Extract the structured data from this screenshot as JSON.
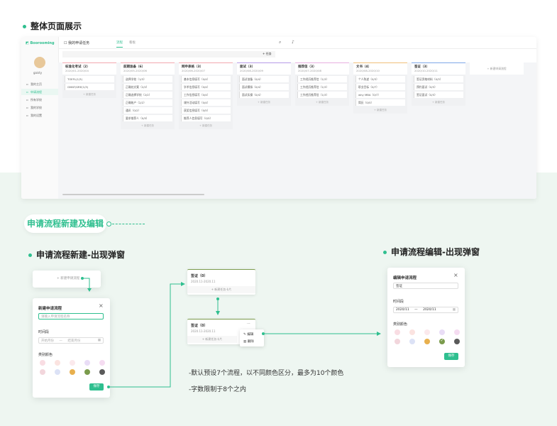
{
  "section1": {
    "title": "整体页面展示"
  },
  "app": {
    "brand": "Boorooming",
    "user": "gaisty",
    "nav": [
      {
        "label": "我的主页",
        "icon": "home-icon"
      },
      {
        "label": "申请流程",
        "icon": "flow-icon",
        "active": true
      },
      {
        "label": "所有学校",
        "icon": "school-icon"
      },
      {
        "label": "我的学校",
        "icon": "bookmark-icon"
      },
      {
        "label": "我的设置",
        "icon": "settings-icon"
      }
    ],
    "topbar": {
      "title": "我的申请任务",
      "tab_active": "流程",
      "tab_other": "看板"
    },
    "add_label": "+ 任务",
    "columns": [
      {
        "name": "标准化考试（2）",
        "date": "2020/01-2020/04",
        "color": "#f2a7b0",
        "cards": [
          "TOEFL(1/3)",
          "GMAT/GRE(1/3)"
        ]
      },
      {
        "name": "前期准备（6）",
        "date": "2020/05-2020/06",
        "color": "#f2a7b0",
        "cards": [
          "选择学校（1/3）",
          "正确处文案（2/2）",
          "正确选择学校（2/2）",
          "正确账户（2/2）",
          "通讯（0/2）",
          "要求推荐人（0/5）"
        ]
      },
      {
        "name": "网申表格（3）",
        "date": "2020/06-2020/07",
        "color": "#f2a7b0",
        "cards": [
          "基本信息填写（0/4）",
          "学术信息填写（0/4）",
          "工作信息填写（0/4）",
          "课外活动填写（0/4）",
          "获奖信息填写（0/5）",
          "推荐人信息填写（0/5）"
        ]
      },
      {
        "name": "面试（3）",
        "date": "2020/08-2020/09",
        "color": "#b79be8",
        "cards": [
          "面试准备（0/4）",
          "面试模拟（0/4）",
          "面试实操（0/4）"
        ]
      },
      {
        "name": "推荐信（3）",
        "date": "2020/07-2020/08",
        "color": "#e8b0e0",
        "cards": [
          "工作经历推荐信（1/3）",
          "工作经历推荐信（1/3）",
          "工作经历推荐信（1/3）"
        ]
      },
      {
        "name": "文书（4）",
        "date": "2020/08-2020/10",
        "color": "#f0c07a",
        "cards": [
          "个人陈述（0/3）",
          "职业目标（0/7）",
          "why MBA（0/7）",
          "简历（0/5）"
        ]
      },
      {
        "name": "签证（3）",
        "date": "2020/10-2020/11",
        "color": "#7fa7e8",
        "cards": [
          "签证资格材料（0/3）",
          "预约面试（0/3）",
          "签证面试（0/3）"
        ]
      }
    ],
    "col_add_label": "+ 新建任务",
    "new_flow_label": "+ 新建申请流程"
  },
  "section2": {
    "pill": "申请流程新建及编辑"
  },
  "create": {
    "title": "申请流程新建-出现弹窗",
    "trigger": "+ 新建申请流程",
    "modal_title": "新建申请流程",
    "name_placeholder": "请输入申请流程名称",
    "period_label": "时间段",
    "start_placeholder": "开始月份",
    "sep": "—",
    "end_placeholder": "结束月份",
    "color_label": "类别颜色",
    "ok": "保存"
  },
  "flow": {
    "card1_name": "签证（0）",
    "card1_date": "2020.11-2020.11",
    "card_add": "+ 新建任务卡片",
    "card2_name": "签证（0）",
    "card2_date": "2020.11-2020.11",
    "more": "···",
    "menu_edit": "编辑",
    "menu_delete": "删除"
  },
  "edit": {
    "title": "申请流程编辑-出现弹窗",
    "modal_title": "编辑申请流程",
    "name_value": "签证",
    "period_label": "时间段",
    "start_value": "2020/11",
    "sep": "—",
    "end_value": "2020/11",
    "color_label": "类别颜色",
    "ok": "保存"
  },
  "notes": {
    "line1": "-默认预设7个流程，以不同颜色区分，最多为10个颜色",
    "line2": "-字数限制于8个之内"
  },
  "colors": {
    "accent": "#2fbf8f",
    "swatches_row1": [
      "#f9dde3",
      "#fbe3e0",
      "#fbe9ec",
      "#e9ddf6",
      "#f5dcf1"
    ],
    "swatches_row2": [
      "#f2d6dc",
      "#dce2f6",
      "#e8b04e",
      "#7a9b4c",
      "#5a5a5a"
    ]
  }
}
